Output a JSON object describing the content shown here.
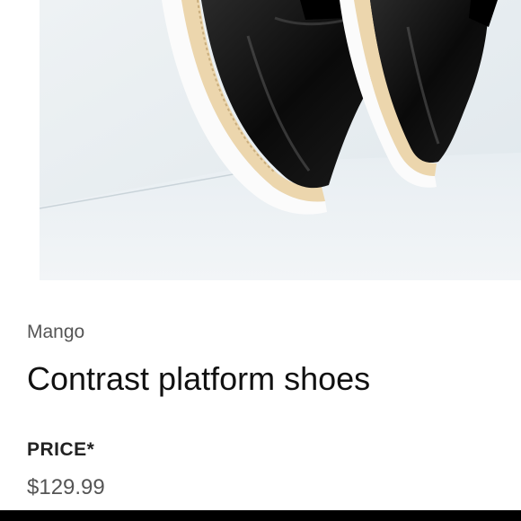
{
  "product": {
    "brand": "Mango",
    "title": "Contrast platform shoes",
    "price_label": "PRICE*",
    "price": "$129.99",
    "image_icon": "product-photo-platform-shoes"
  },
  "colors": {
    "title": "#111111",
    "brand": "#555555",
    "price": "#555555",
    "shoe": "#111111",
    "sole_cream": "#ecd6ad"
  }
}
